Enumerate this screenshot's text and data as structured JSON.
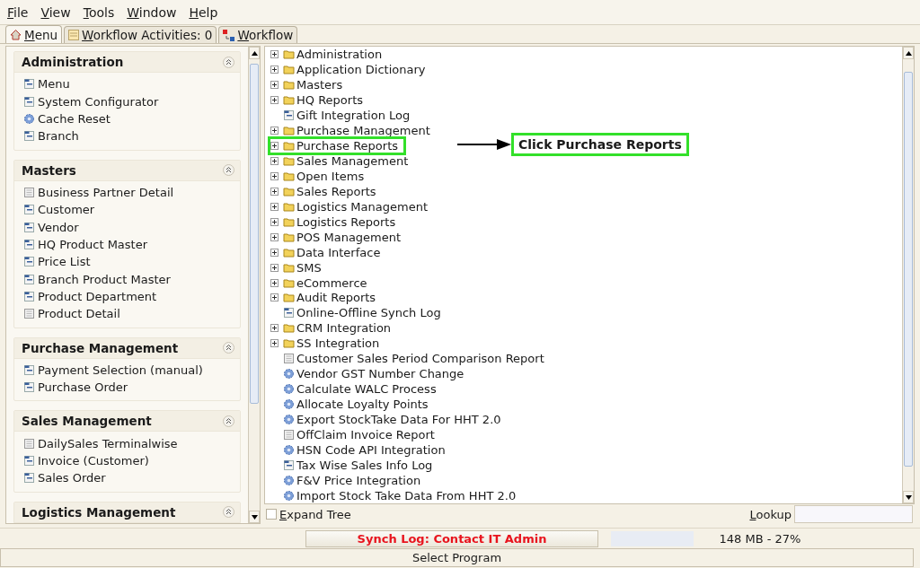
{
  "menu_bar": [
    "File",
    "View",
    "Tools",
    "Window",
    "Help"
  ],
  "tabs": [
    {
      "label": "Menu",
      "selected": true
    },
    {
      "label": "Workflow Activities: 0",
      "selected": false
    },
    {
      "label": "Workflow",
      "selected": false
    }
  ],
  "sidebar": {
    "sections": [
      {
        "title": "Administration",
        "expanded": true,
        "items": [
          {
            "label": "Menu",
            "kind": "window"
          },
          {
            "label": "System Configurator",
            "kind": "window"
          },
          {
            "label": "Cache Reset",
            "kind": "process"
          },
          {
            "label": "Branch",
            "kind": "window"
          }
        ]
      },
      {
        "title": "Masters",
        "expanded": true,
        "items": [
          {
            "label": "Business Partner Detail",
            "kind": "report"
          },
          {
            "label": "Customer",
            "kind": "window"
          },
          {
            "label": "Vendor",
            "kind": "window"
          },
          {
            "label": "HQ Product Master",
            "kind": "window"
          },
          {
            "label": "Price List",
            "kind": "window"
          },
          {
            "label": "Branch Product Master",
            "kind": "window"
          },
          {
            "label": "Product Department",
            "kind": "window"
          },
          {
            "label": "Product Detail",
            "kind": "report"
          }
        ]
      },
      {
        "title": "Purchase Management",
        "expanded": true,
        "items": [
          {
            "label": "Payment Selection (manual)",
            "kind": "window"
          },
          {
            "label": "Purchase Order",
            "kind": "window"
          }
        ]
      },
      {
        "title": "Sales Management",
        "expanded": true,
        "items": [
          {
            "label": "DailySales Terminalwise",
            "kind": "report"
          },
          {
            "label": "Invoice (Customer)",
            "kind": "window"
          },
          {
            "label": "Sales Order",
            "kind": "window"
          }
        ]
      },
      {
        "title": "Logistics Management",
        "expanded": true
      }
    ]
  },
  "tree": {
    "items": [
      {
        "label": "Administration",
        "kind": "folder",
        "highlighted": false
      },
      {
        "label": "Application Dictionary",
        "kind": "folder",
        "highlighted": false
      },
      {
        "label": "Masters",
        "kind": "folder",
        "highlighted": false
      },
      {
        "label": "HQ Reports",
        "kind": "folder",
        "highlighted": false
      },
      {
        "label": "Gift Integration Log",
        "kind": "window",
        "highlighted": false
      },
      {
        "label": "Purchase Management",
        "kind": "folder",
        "highlighted": false
      },
      {
        "label": "Purchase Reports",
        "kind": "folder",
        "highlighted": true
      },
      {
        "label": "Sales Management",
        "kind": "folder",
        "highlighted": false
      },
      {
        "label": "Open Items",
        "kind": "folder",
        "highlighted": false
      },
      {
        "label": "Sales Reports",
        "kind": "folder",
        "highlighted": false
      },
      {
        "label": "Logistics Management",
        "kind": "folder",
        "highlighted": false
      },
      {
        "label": "Logistics Reports",
        "kind": "folder",
        "highlighted": false
      },
      {
        "label": "POS Management",
        "kind": "folder",
        "highlighted": false
      },
      {
        "label": "Data Interface",
        "kind": "folder",
        "highlighted": false
      },
      {
        "label": "SMS",
        "kind": "folder",
        "highlighted": false
      },
      {
        "label": "eCommerce",
        "kind": "folder",
        "highlighted": false
      },
      {
        "label": "Audit Reports",
        "kind": "folder",
        "highlighted": false
      },
      {
        "label": "Online-Offline Synch Log",
        "kind": "window",
        "highlighted": false
      },
      {
        "label": "CRM Integration",
        "kind": "folder",
        "highlighted": false
      },
      {
        "label": "SS Integration",
        "kind": "folder",
        "highlighted": false
      },
      {
        "label": "Customer Sales Period Comparison Report",
        "kind": "report",
        "highlighted": false
      },
      {
        "label": "Vendor GST Number Change",
        "kind": "process",
        "highlighted": false
      },
      {
        "label": "Calculate WALC Process",
        "kind": "process",
        "highlighted": false
      },
      {
        "label": "Allocate Loyalty Points",
        "kind": "process",
        "highlighted": false
      },
      {
        "label": "Export StockTake Data For HHT 2.0",
        "kind": "process",
        "highlighted": false
      },
      {
        "label": "OffClaim Invoice Report",
        "kind": "report",
        "highlighted": false
      },
      {
        "label": "HSN Code API Integration",
        "kind": "process",
        "highlighted": false
      },
      {
        "label": "Tax Wise Sales Info Log",
        "kind": "window",
        "highlighted": false
      },
      {
        "label": "F&V Price Integration",
        "kind": "process",
        "highlighted": false
      },
      {
        "label": "Import Stock Take Data From HHT 2.0",
        "kind": "process",
        "highlighted": false
      }
    ],
    "callout": "Click Purchase Reports",
    "expand_tree": {
      "label": "Expand Tree",
      "checked": false
    },
    "lookup": {
      "label": "Lookup"
    }
  },
  "status": {
    "message": "Synch Log: Contact IT Admin",
    "memory": "148 MB - 27%",
    "program": "Select Program"
  }
}
